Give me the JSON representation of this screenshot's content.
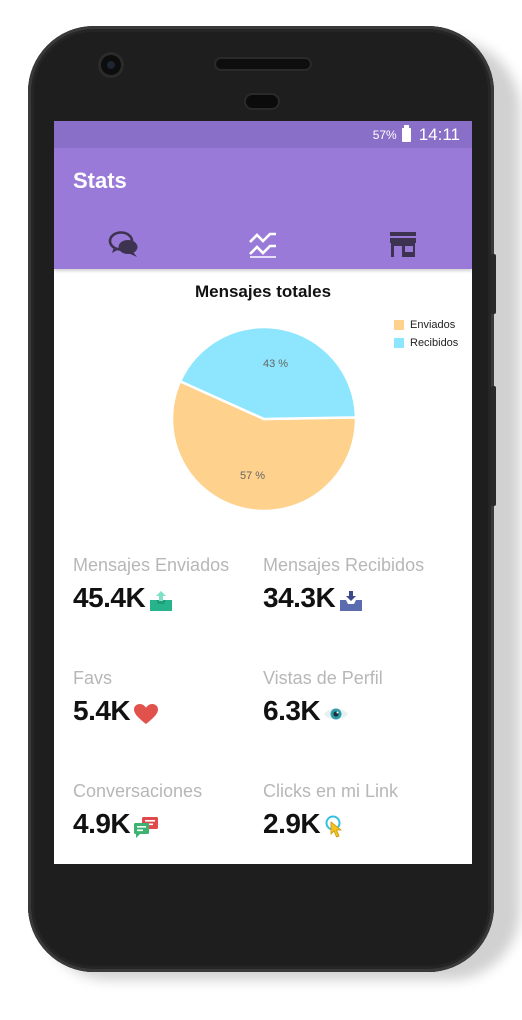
{
  "status_bar": {
    "battery": "57%",
    "time": "14:11"
  },
  "app_bar": {
    "title": "Stats",
    "tabs": [
      {
        "icon": "chat-bubbles-icon",
        "active": false
      },
      {
        "icon": "trending-chart-icon",
        "active": true
      },
      {
        "icon": "store-icon",
        "active": false
      }
    ]
  },
  "colors": {
    "status_bar": "#8a6fc9",
    "app_bar": "#9a7ad8",
    "sent": "#fed18d",
    "received": "#8de6fd",
    "label": "#b7b7b7"
  },
  "chart_data": {
    "type": "pie",
    "title": "Mensajes totales",
    "legend_position": "top-right",
    "slices": [
      {
        "name": "Enviados",
        "value": 57,
        "label": "57 %",
        "color": "#fed18d"
      },
      {
        "name": "Recibidos",
        "value": 43,
        "label": "43 %",
        "color": "#8de6fd"
      }
    ]
  },
  "stats": [
    {
      "label": "Mensajes Enviados",
      "value": "45.4K",
      "icon": "outbox-icon"
    },
    {
      "label": "Mensajes Recibidos",
      "value": "34.3K",
      "icon": "inbox-icon"
    },
    {
      "label": "Favs",
      "value": "5.4K",
      "icon": "heart-icon"
    },
    {
      "label": "Vistas de Perfil",
      "value": "6.3K",
      "icon": "eye-icon"
    },
    {
      "label": "Conversaciones",
      "value": "4.9K",
      "icon": "conversation-icon"
    },
    {
      "label": "Clicks en mi Link",
      "value": "2.9K",
      "icon": "pointer-click-icon"
    }
  ]
}
